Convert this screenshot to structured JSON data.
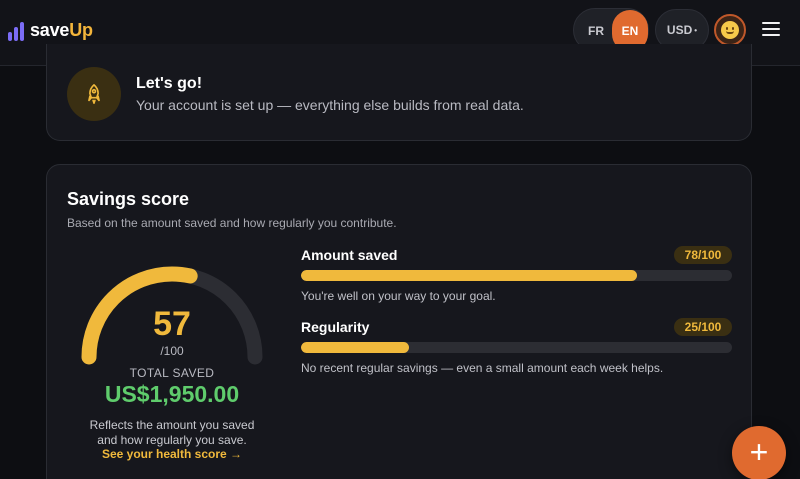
{
  "app": {
    "brand_a": "save",
    "brand_b": "Up",
    "brand_color": "#f3b53b",
    "logo_color": "#7b6cf6"
  },
  "header": {
    "lang_fr": "FR",
    "lang_en": "EN",
    "currency": "USD",
    "currency_caret": "•",
    "accent": "#e06a2f"
  },
  "welcome": {
    "icon": "rocket-icon",
    "title": "Let's go!",
    "subtitle": "Your account is set up — everything else builds from real data."
  },
  "score": {
    "title": "Savings score",
    "description": "Based on the amount saved and how regularly you contribute.",
    "value": "57",
    "value_fraction": 0.57,
    "max": "/100",
    "total_label": "TOTAL SAVED",
    "total_value": "US$1,950.00",
    "reflect_line1": "Reflects the amount you saved",
    "reflect_line2": "and how regularly you save.",
    "health_link": "See your health score →",
    "gauge_color": "#f0b93c",
    "total_color": "#5fcc6c"
  },
  "metrics": [
    {
      "label": "Amount saved",
      "badge": "78/100",
      "fraction": 0.78,
      "note": "You're well on your way to your goal."
    },
    {
      "label": "Regularity",
      "badge": "25/100",
      "fraction": 0.25,
      "note": "No recent regular savings — even a small amount each week helps."
    }
  ],
  "fab": {
    "label": "+"
  }
}
